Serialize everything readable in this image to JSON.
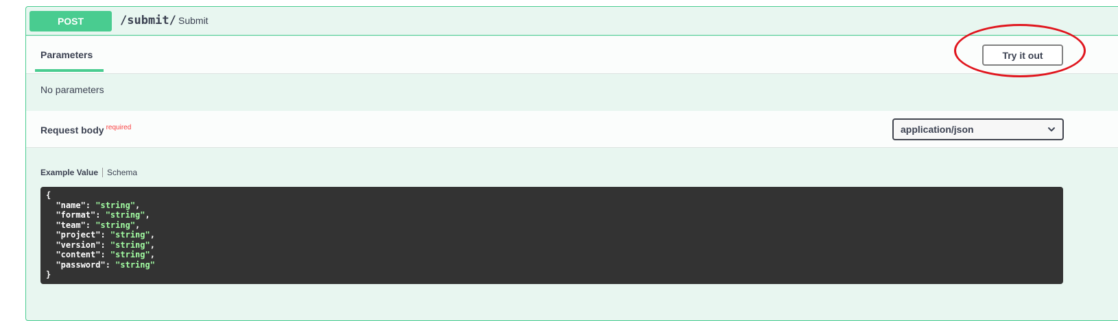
{
  "operation": {
    "method": "POST",
    "path": "/submit/",
    "summary": "Submit"
  },
  "parameters": {
    "tab_label": "Parameters",
    "try_button_label": "Try it out",
    "empty_text": "No parameters"
  },
  "request_body": {
    "title": "Request body",
    "required_label": "required",
    "content_type": "application/json"
  },
  "example": {
    "tabs": [
      "Example Value",
      "Schema"
    ],
    "open_brace": "{",
    "close_brace": "}",
    "fields": [
      {
        "key": "  \"name\": ",
        "value": "\"string\"",
        "sep": ","
      },
      {
        "key": "  \"format\": ",
        "value": "\"string\"",
        "sep": ","
      },
      {
        "key": "  \"team\": ",
        "value": "\"string\"",
        "sep": ","
      },
      {
        "key": "  \"project\": ",
        "value": "\"string\"",
        "sep": ","
      },
      {
        "key": "  \"version\": ",
        "value": "\"string\"",
        "sep": ","
      },
      {
        "key": "  \"content\": ",
        "value": "\"string\"",
        "sep": ","
      },
      {
        "key": "  \"password\": ",
        "value": "\"string\"",
        "sep": ""
      }
    ]
  },
  "colors": {
    "post_green": "#49cc90",
    "block_bg": "#e8f6f0",
    "required_red": "#f93e3e",
    "annotation_red": "#e0161e",
    "code_bg": "#333333",
    "code_string": "#a2fca2"
  }
}
